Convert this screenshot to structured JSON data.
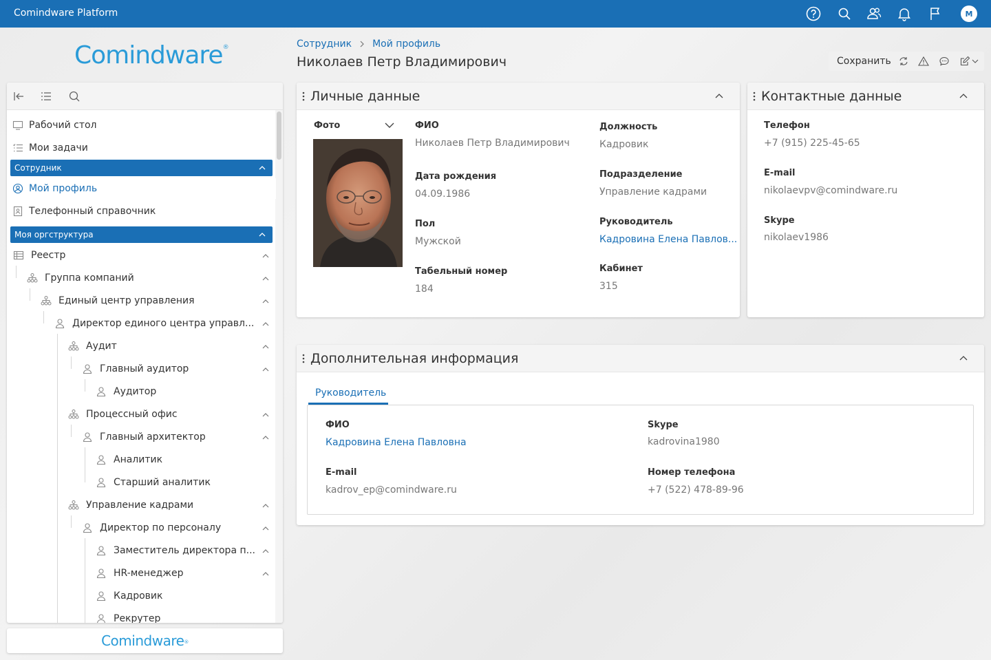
{
  "app": {
    "title": "Comindware Platform",
    "user_initial": "M"
  },
  "colors": {
    "brand": "#1a6fb5",
    "logo": "#2a9bd8"
  },
  "logo": {
    "text": "Comindware",
    "reg": "®"
  },
  "topbar_icons": [
    "help-icon",
    "search-icon",
    "users-icon",
    "bell-icon",
    "flag-icon"
  ],
  "sidebar": {
    "toolbar_icons": [
      "collapse-icon",
      "list-icon",
      "search-icon"
    ],
    "items": [
      {
        "label": "Рабочий стол",
        "icon": "desktop-icon"
      },
      {
        "label": "Мои задачи",
        "icon": "tasks-icon"
      }
    ],
    "section_employee": "Сотрудник",
    "employee_items": [
      {
        "label": "Мой профиль",
        "icon": "profile-icon",
        "active": true
      },
      {
        "label": "Телефонный справочник",
        "icon": "phonebook-icon"
      }
    ],
    "section_org": "Моя оргструктура",
    "tree": [
      {
        "label": "Реестр",
        "type": "registry"
      },
      {
        "label": "Группа компаний",
        "type": "org"
      },
      {
        "label": "Единый центр управления",
        "type": "org"
      },
      {
        "label": "Директор единого центра управл...",
        "type": "person"
      },
      {
        "label": "Аудит",
        "type": "org"
      },
      {
        "label": "Главный аудитор",
        "type": "person"
      },
      {
        "label": "Аудитор",
        "type": "person"
      },
      {
        "label": "Процессный офис",
        "type": "org"
      },
      {
        "label": "Главный архитектор",
        "type": "person"
      },
      {
        "label": "Аналитик",
        "type": "person"
      },
      {
        "label": "Старший аналитик",
        "type": "person"
      },
      {
        "label": "Управление кадрами",
        "type": "org"
      },
      {
        "label": "Директор по персоналу",
        "type": "person"
      },
      {
        "label": "Заместитель директора п...",
        "type": "person"
      },
      {
        "label": "HR-менеджер",
        "type": "person"
      },
      {
        "label": "Кадровик",
        "type": "person"
      },
      {
        "label": "Рекрутер",
        "type": "person"
      }
    ]
  },
  "header": {
    "breadcrumb": [
      "Сотрудник",
      "Мой профиль"
    ],
    "title": "Николаев Петр Владимирович",
    "save_label": "Сохранить"
  },
  "personal": {
    "title": "Личные данные",
    "photo_label": "Фото",
    "fio_label": "ФИО",
    "fio": "Николаев Петр  Владимирович",
    "birth_label": "Дата рождения",
    "birth": "04.09.1986",
    "gender_label": "Пол",
    "gender": "Мужской",
    "tabnum_label": "Табельный номер",
    "tabnum": "184",
    "position_label": "Должность",
    "position": "Кадровик",
    "dept_label": "Подразделение",
    "dept": "Управление кадрами",
    "manager_label": "Руководитель",
    "manager": "Кадровина Елена Павлов...",
    "office_label": "Кабинет",
    "office": "315"
  },
  "contacts": {
    "title": "Контактные данные",
    "phone_label": "Телефон",
    "phone": "+7 (915) 225-45-65",
    "email_label": "E-mail",
    "email": "nikolaevpv@comindware.ru",
    "skype_label": "Skype",
    "skype": "nikolaev1986"
  },
  "additional": {
    "title": "Дополнительная информация",
    "tab": "Руководитель",
    "fio_label": "ФИО",
    "fio": "Кадровина Елена Павловна",
    "email_label": "E-mail",
    "email": "kadrov_ep@comindware.ru",
    "skype_label": "Skype",
    "skype": "kadrovina1980",
    "phone_label": "Номер телефона",
    "phone": "+7 (522) 478-89-96"
  }
}
